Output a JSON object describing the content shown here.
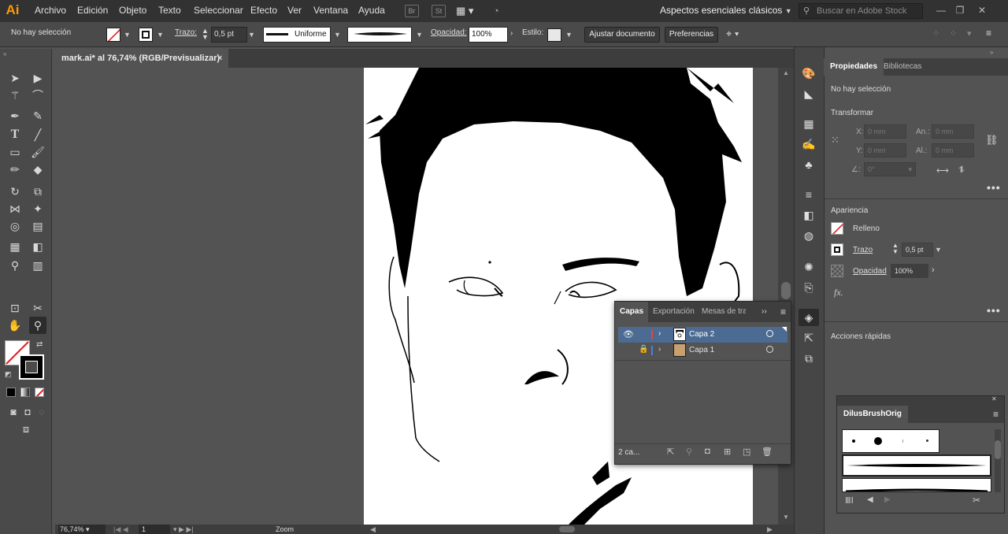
{
  "app": {
    "logo": "Ai",
    "menus": [
      "Archivo",
      "Edición",
      "Objeto",
      "Texto",
      "Seleccionar",
      "Efecto",
      "Ver",
      "Ventana",
      "Ayuda"
    ],
    "bridge_icon": "Br",
    "stock_icon": "St",
    "workspace": "Aspectos esenciales clásicos",
    "search_placeholder": "Buscar en Adobe Stock"
  },
  "control": {
    "selection": "No hay selección",
    "stroke_label": "Trazo:",
    "stroke_value": "0,5 pt",
    "profile": "Uniforme",
    "opacity_label": "Opacidad:",
    "opacity_value": "100%",
    "style_label": "Estilo:",
    "doc_setup_button": "Ajustar documento",
    "prefs_button": "Preferencias"
  },
  "document": {
    "tab_title": "mark.ai* al 76,74% (RGB/Previsualizar)",
    "close": "×"
  },
  "status": {
    "zoom": "76,74%",
    "page": "1",
    "tool": "Zoom"
  },
  "properties": {
    "tabs": [
      "Propiedades",
      "Bibliotecas"
    ],
    "selection": "No hay selección",
    "transform_heading": "Transformar",
    "x_label": "X:",
    "y_label": "Y:",
    "w_label": "An.:",
    "h_label": "Al.:",
    "x_value": "0 mm",
    "y_value": "0 mm",
    "w_value": "0 mm",
    "h_value": "0 mm",
    "angle_value": "0°",
    "appearance_heading": "Apariencia",
    "fill_label": "Relleno",
    "stroke_label": "Trazo",
    "stroke_value": "0,5 pt",
    "opacity_label": "Opacidad",
    "opacity_value": "100%",
    "fx_label": "fx.",
    "quick_actions": "Acciones rápidas"
  },
  "layers_panel": {
    "tabs": [
      "Capas",
      "Exportación",
      "Mesas de tra"
    ],
    "layers": [
      {
        "name": "Capa 2",
        "color": "#e0453e",
        "selected": true
      },
      {
        "name": "Capa 1",
        "color": "#4f7fd8",
        "selected": false
      }
    ],
    "count": "2 ca..."
  },
  "brushes_panel": {
    "title": "DilusBrushOrig"
  },
  "colors": {
    "accent_selected": "#4b6b93",
    "logo": "#ff9a00"
  }
}
